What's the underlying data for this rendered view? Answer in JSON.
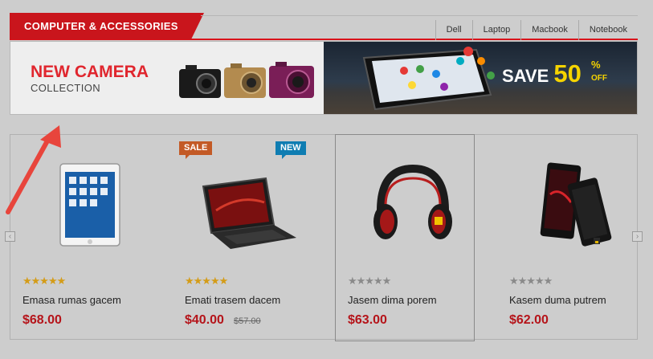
{
  "section": {
    "title": "COMPUTER & ACCESSORIES",
    "tabs": [
      "Dell",
      "Laptop",
      "Macbook",
      "Notebook"
    ]
  },
  "banner": {
    "left_title": "NEW CAMERA",
    "left_subtitle": "COLLECTION",
    "save_word": "SAVE",
    "save_number": "50",
    "save_unit": "%",
    "save_off": "OFF"
  },
  "products": [
    {
      "name": "Emasa rumas gacem",
      "price": "$68.00",
      "old_price": "",
      "badge": "",
      "rating": 5,
      "image": "tablet-icon"
    },
    {
      "name": "Emati trasem dacem",
      "price": "$40.00",
      "old_price": "$57.00",
      "badge": "SALE",
      "badge2": "NEW",
      "rating": 5,
      "image": "laptop-icon"
    },
    {
      "name": "Jasem dima porem",
      "price": "$63.00",
      "old_price": "",
      "badge": "",
      "rating": 0,
      "image": "headphones-icon"
    },
    {
      "name": "Kasem duma putrem",
      "price": "$62.00",
      "old_price": "",
      "badge": "",
      "rating": 0,
      "image": "smartphone-icon"
    }
  ],
  "colors": {
    "accent_red": "#c9151c",
    "price_red": "#b5141a",
    "sale_badge": "#c35a26",
    "new_badge": "#0f7db2",
    "annotation_arrow": "#e8453c"
  }
}
